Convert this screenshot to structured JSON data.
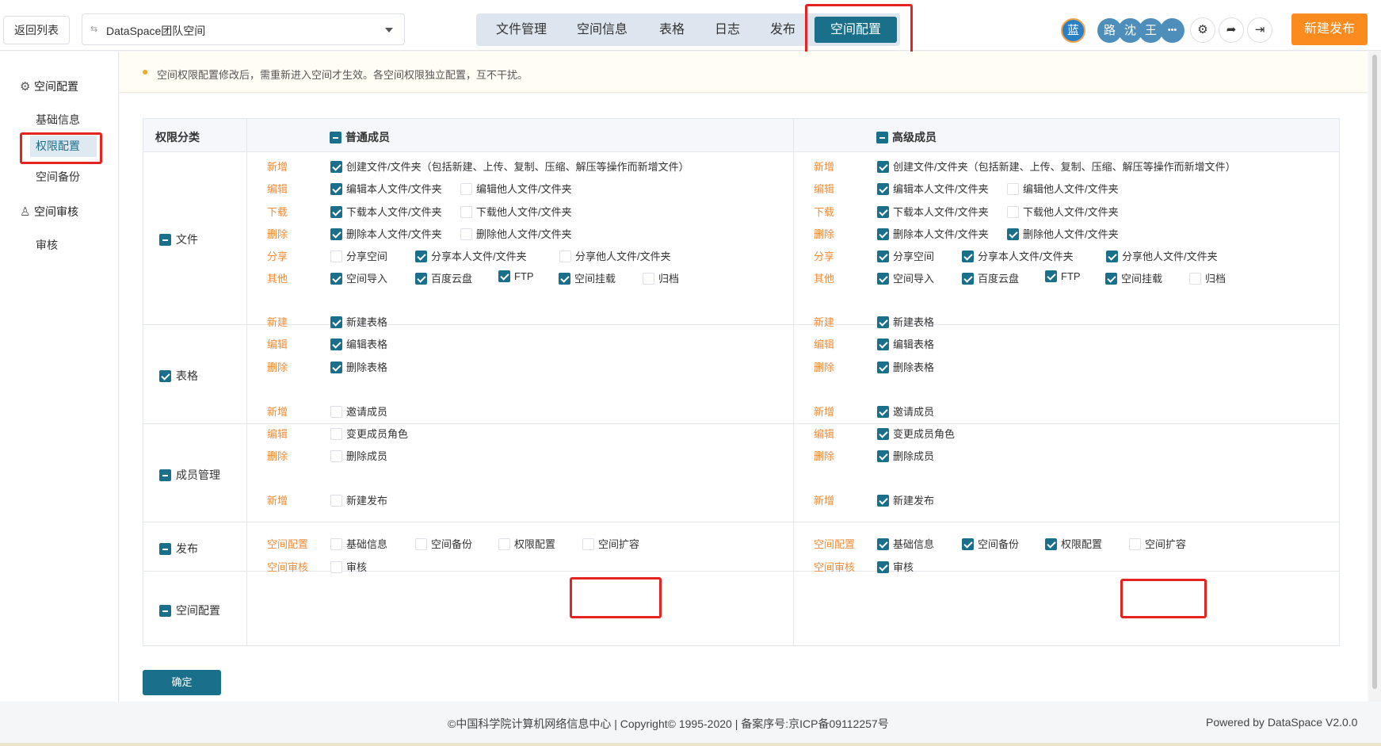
{
  "header": {
    "back_label": "返回列表",
    "space_select_value": "DataSpace团队空间",
    "nav_tabs": [
      "文件管理",
      "空间信息",
      "表格",
      "日志",
      "发布",
      "空间配置"
    ],
    "active_tab": "空间配置",
    "avatars": [
      {
        "text": "蓝",
        "color": "#2b7fc4"
      },
      {
        "text": "路",
        "color": "#4d8fba"
      },
      {
        "text": "沈",
        "color": "#4d8fba"
      },
      {
        "text": "王",
        "color": "#4d8fba"
      },
      {
        "text": "•••",
        "color": "#4d8fba"
      }
    ],
    "new_publish_label": "新建发布",
    "accent": "#1a6f8a",
    "orange": "#fb8b1e"
  },
  "sidebar": {
    "group1": "空间配置",
    "items1": [
      "基础信息",
      "权限配置",
      "空间备份"
    ],
    "group2": "空间审核",
    "items2": [
      "审核"
    ],
    "active_item": "权限配置"
  },
  "notice": "空间权限配置修改后，需重新进入空间才生效。各空间权限独立配置，互不干扰。",
  "table": {
    "col_category": "权限分类",
    "col_normal": "普通成员",
    "col_senior": "高级成员",
    "categories": [
      "文件",
      "表格",
      "成员管理",
      "发布",
      "空间配置"
    ],
    "actions": {
      "add": "新增",
      "edit": "编辑",
      "download": "下载",
      "delete": "删除",
      "share": "分享",
      "other": "其他",
      "create": "新建",
      "space_config": "空间配置",
      "space_audit": "空间审核"
    },
    "options": {
      "create_file": "创建文件/文件夹（包括新建、上传、复制、压缩、解压等操作而新增文件）",
      "edit_own": "编辑本人文件/文件夹",
      "edit_other": "编辑他人文件/文件夹",
      "dl_own": "下载本人文件/文件夹",
      "dl_other": "下载他人文件/文件夹",
      "del_own": "删除本人文件/文件夹",
      "del_other": "删除他人文件/文件夹",
      "share_space": "分享空间",
      "share_own": "分享本人文件/文件夹",
      "share_other": "分享他人文件/文件夹",
      "import": "空间导入",
      "baidu": "百度云盘",
      "ftp": "FTP",
      "mount": "空间挂载",
      "archive": "归档",
      "new_table": "新建表格",
      "edit_table": "编辑表格",
      "del_table": "删除表格",
      "invite": "邀请成员",
      "change_role": "变更成员角色",
      "del_member": "删除成员",
      "new_publish": "新建发布",
      "basic_info": "基础信息",
      "backup": "空间备份",
      "perm_config": "权限配置",
      "expand": "空间扩容",
      "audit": "审核"
    },
    "checked": {
      "normal": {
        "create_file": true,
        "edit_own": true,
        "edit_other": false,
        "dl_own": true,
        "dl_other": false,
        "del_own": true,
        "del_other": false,
        "share_space": false,
        "share_own": true,
        "share_other": false,
        "import": true,
        "baidu": true,
        "ftp": true,
        "mount": true,
        "archive": false,
        "new_table": true,
        "edit_table": true,
        "del_table": true,
        "invite": false,
        "change_role": false,
        "del_member": false,
        "new_publish": false,
        "basic_info": false,
        "backup": false,
        "perm_config": false,
        "expand": false,
        "audit": false
      },
      "senior": {
        "create_file": true,
        "edit_own": true,
        "edit_other": false,
        "dl_own": true,
        "dl_other": false,
        "del_own": true,
        "del_other": true,
        "share_space": true,
        "share_own": true,
        "share_other": true,
        "import": true,
        "baidu": true,
        "ftp": true,
        "mount": true,
        "archive": false,
        "new_table": true,
        "edit_table": true,
        "del_table": true,
        "invite": true,
        "change_role": true,
        "del_member": true,
        "new_publish": true,
        "basic_info": true,
        "backup": true,
        "perm_config": true,
        "expand": false,
        "audit": true
      }
    }
  },
  "confirm_label": "确定",
  "footer": {
    "center": "©中国科学院计算机网络信息中心  |  Copyright© 1995-2020  |  备案序号:京ICP备09112257号",
    "right": "Powered by DataSpace V2.0.0"
  }
}
